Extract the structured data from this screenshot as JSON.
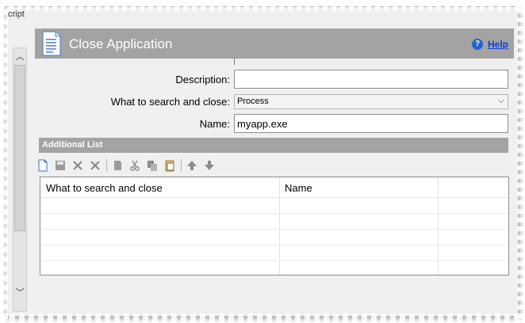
{
  "left_strip": {
    "label": "cript"
  },
  "header": {
    "title": "Close Application",
    "help_label": "Help",
    "help_icon_glyph": "?",
    "color": "#a3a3a3"
  },
  "form": {
    "description_label": "Description:",
    "description_value": "",
    "what_label": "What to search and close:",
    "what_value": "Process",
    "name_label": "Name:",
    "name_value": "myapp.exe"
  },
  "additional_list": {
    "title": "Additional List",
    "toolbar_icons": [
      "new-icon",
      "save-icon",
      "delete-icon",
      "delete-all-icon",
      "copy-icon",
      "cut-icon",
      "copy-duplicate-icon",
      "paste-icon",
      "move-up-icon",
      "move-down-icon"
    ],
    "columns": [
      "What to search and close",
      "Name",
      ""
    ],
    "rows": []
  },
  "colors": {
    "panel_bg": "#f0f0f0",
    "header_bg": "#a3a3a3",
    "help_link": "#0b3fd6"
  }
}
